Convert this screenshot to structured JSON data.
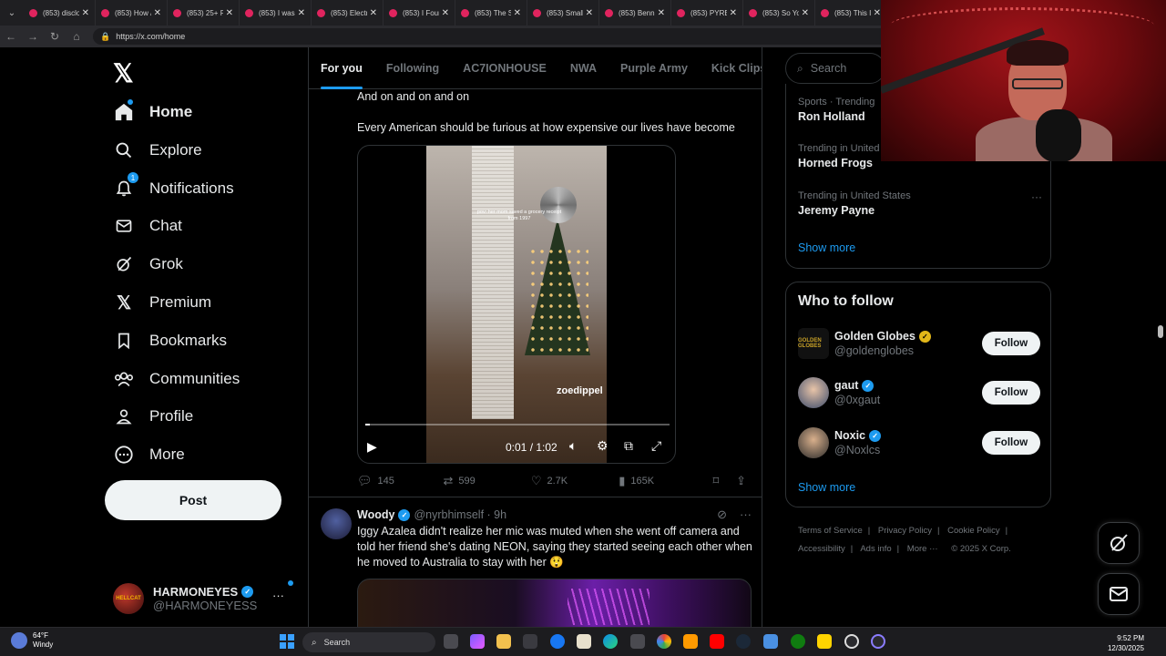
{
  "browser": {
    "tabs": [
      "(853) disclo",
      "(853) How /",
      "(853) 25+ F",
      "(853) I was",
      "(853) Electr",
      "(853) I Foun",
      "(853) The S",
      "(853) Small",
      "(853) Benn",
      "(853) PYREX",
      "(853) So Yo",
      "(853) This I"
    ],
    "url": "https://x.com/home"
  },
  "sidebar": {
    "logo": "𝕏",
    "items": [
      {
        "label": "Home",
        "icon": "home-icon"
      },
      {
        "label": "Explore",
        "icon": "search-icon"
      },
      {
        "label": "Notifications",
        "icon": "bell-icon",
        "badge": "1"
      },
      {
        "label": "Chat",
        "icon": "mail-icon"
      },
      {
        "label": "Grok",
        "icon": "grok-icon"
      },
      {
        "label": "Premium",
        "icon": "x-logo-icon"
      },
      {
        "label": "Bookmarks",
        "icon": "bookmark-icon"
      },
      {
        "label": "Communities",
        "icon": "people-icon"
      },
      {
        "label": "Profile",
        "icon": "person-icon"
      },
      {
        "label": "More",
        "icon": "more-circle-icon"
      }
    ],
    "post_label": "Post",
    "account": {
      "name": "HARMONEYES",
      "handle": "@HARMONEYESS",
      "avatar_text": "HELLCAT"
    }
  },
  "feed": {
    "tabs": [
      "For you",
      "Following",
      "AC7IONHOUSE",
      "NWA",
      "Purple Army",
      "Kick Clips"
    ],
    "tweet1": {
      "line1": "And on and on and on",
      "line2": "Every American should be furious at how expensive our lives have become",
      "video_caption": "pov: her mom saved a grocery receipt from 1997",
      "video_watermark": "zoedippel",
      "video_time": "0:01 / 1:02",
      "progress": 0.016,
      "replies": "145",
      "reposts": "599",
      "likes": "2.7K",
      "views": "165K"
    },
    "tweet2": {
      "name": "Woody",
      "handle": "@nyrbhimself · 9h",
      "text": "Iggy Azalea didn't realize her mic was muted when she went off camera and told her friend she's dating NEON, saying they started seeing each other when he moved to Australia to stay with her 😲"
    }
  },
  "right": {
    "search_placeholder": "Search",
    "trends": [
      {
        "context": "Sports · Trending",
        "name": "Ron Holland"
      },
      {
        "context": "Trending in United",
        "name": "Horned Frogs"
      },
      {
        "context": "Trending in United States",
        "name": "Jeremy Payne"
      }
    ],
    "show_more": "Show more",
    "who_to_follow": {
      "title": "Who to follow",
      "items": [
        {
          "name": "Golden Globes",
          "handle": "@goldenglobes",
          "avatar_text": "GOLDEN GLOBES",
          "badge": "gold"
        },
        {
          "name": "gaut",
          "handle": "@0xgaut",
          "avatar_text": "",
          "badge": "blue"
        },
        {
          "name": "Noxic",
          "handle": "@Noxlcs",
          "avatar_text": "",
          "badge": "blue"
        }
      ],
      "follow_label": "Follow",
      "show_more": "Show more"
    },
    "footer": [
      "Terms of Service",
      "Privacy Policy",
      "Cookie Policy",
      "Accessibility",
      "Ads info",
      "More ···",
      "© 2025 X Corp."
    ]
  },
  "taskbar": {
    "weather_temp": "64°F",
    "weather_desc": "Windy",
    "search": "Search",
    "time": "9:52 PM",
    "date": "12/30/2025"
  },
  "colors": {
    "accent": "#1d9bf0",
    "background": "#000000",
    "text": "#e7e9ea",
    "muted": "#71767b"
  }
}
